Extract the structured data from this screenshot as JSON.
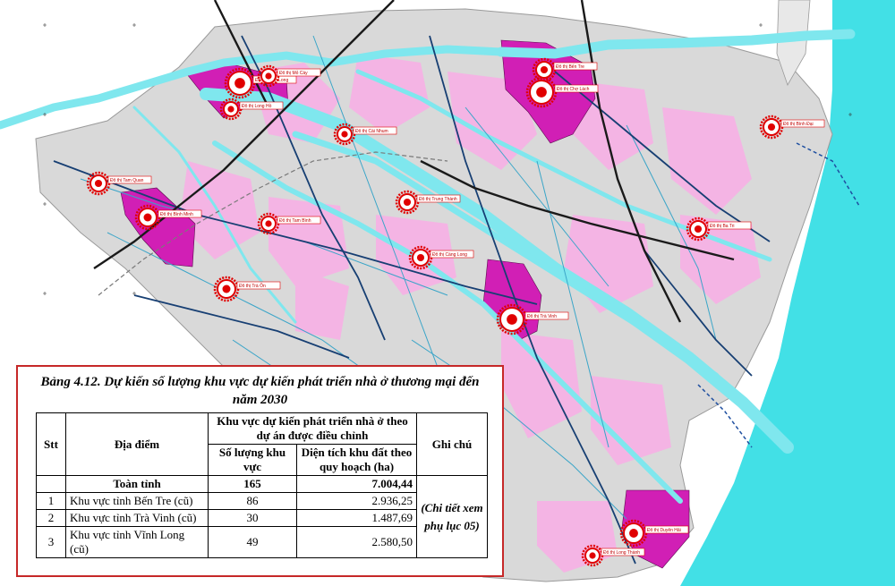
{
  "map": {
    "colors": {
      "sea": "#42e0e6",
      "land": "#d9d9d9",
      "urban_core": "#d11fb5",
      "urban_pink": "#f4b4e4",
      "river": "#7fe7ee",
      "expressway": "#1a1a1a",
      "main_road": "#173f73",
      "local_road": "#3aa5c8",
      "marker": "#e00000"
    },
    "towns": [
      {
        "label": "Đô thị Vĩnh Long"
      },
      {
        "label": "Đô thị Chợ Lách"
      },
      {
        "label": "Đô thị Bến Tre"
      },
      {
        "label": "Đô thị Long Hồ"
      },
      {
        "label": "Đô thị Cái Nhum"
      },
      {
        "label": "Đô thị Bình Đại"
      },
      {
        "label": "Đô thị Tam Quan"
      },
      {
        "label": "Đô thị Mỏ Cày"
      },
      {
        "label": "Đô thị Bình Minh"
      },
      {
        "label": "Đô thị Trung Thành"
      },
      {
        "label": "Đô thị Tam Bình"
      },
      {
        "label": "Đô thị Ba Tri"
      },
      {
        "label": "Đô thị Càng Long"
      },
      {
        "label": "Đô thị Trà Ôn"
      },
      {
        "label": "Đô thị Trà Vinh"
      },
      {
        "label": "Đô thị Duyên Hải"
      },
      {
        "label": "Đô thị Long Thành"
      }
    ]
  },
  "table": {
    "caption": "Bảng 4.12. Dự kiến số lượng khu vực dự kiến phát triển nhà ở thương mại đến năm 2030",
    "headers": {
      "stt": "Stt",
      "location": "Địa điểm",
      "group": "Khu vực dự kiến phát triển nhà ở theo dự án được điều chỉnh",
      "count": "Số lượng khu vực",
      "area": "Diện tích khu đất theo quy hoạch (ha)",
      "note": "Ghi chú"
    },
    "total": {
      "label": "Toàn tỉnh",
      "count": "165",
      "area": "7.004,44"
    },
    "rows": [
      {
        "stt": "1",
        "location": "Khu vực tỉnh Bến Tre (cũ)",
        "count": "86",
        "area": "2.936,25"
      },
      {
        "stt": "2",
        "location": "Khu vực tỉnh Trà Vinh (cũ)",
        "count": "30",
        "area": "1.487,69"
      },
      {
        "stt": "3",
        "location": "Khu vực tỉnh Vĩnh Long (cũ)",
        "count": "49",
        "area": "2.580,50"
      }
    ],
    "note": "(Chi tiết xem phụ lục 05)"
  }
}
